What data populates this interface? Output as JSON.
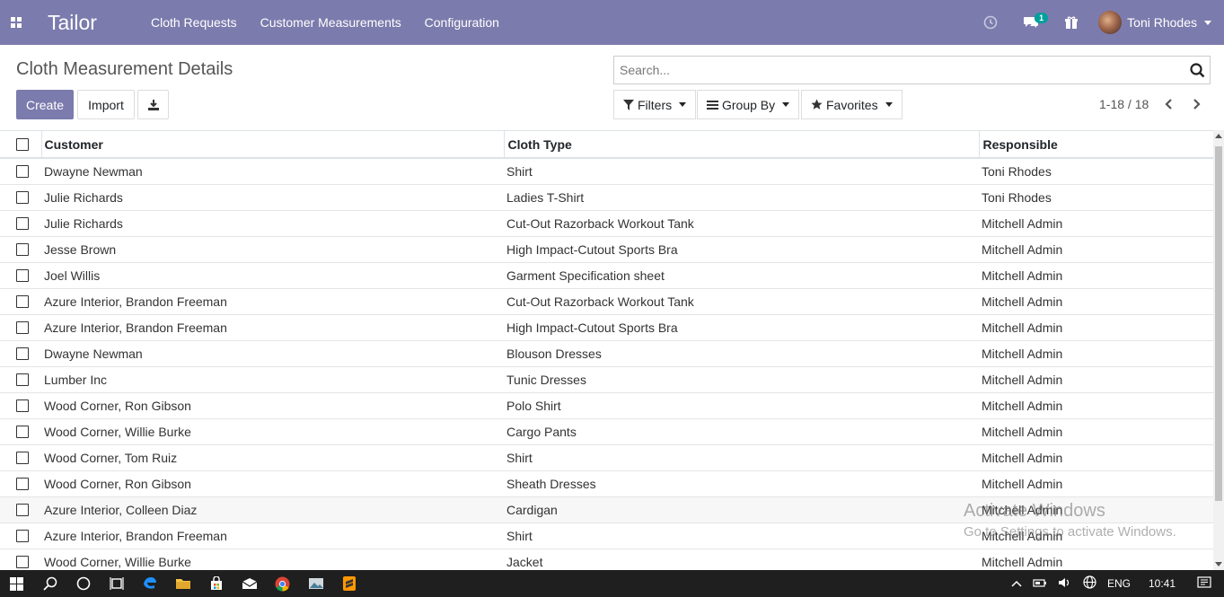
{
  "navbar": {
    "brand": "Tailor",
    "menu": [
      "Cloth Requests",
      "Customer Measurements",
      "Configuration"
    ],
    "chat_badge": "1",
    "user_name": "Toni Rhodes",
    "color": "#7c7bad"
  },
  "control_panel": {
    "title": "Cloth Measurement Details",
    "create_label": "Create",
    "import_label": "Import",
    "search_placeholder": "Search...",
    "filters_label": "Filters",
    "groupby_label": "Group By",
    "favorites_label": "Favorites",
    "pager_text": "1-18 / 18"
  },
  "table": {
    "columns": [
      "Customer",
      "Cloth Type",
      "Responsible"
    ],
    "rows": [
      [
        "Dwayne Newman",
        "Shirt",
        "Toni Rhodes"
      ],
      [
        "Julie Richards",
        "Ladies T-Shirt",
        "Toni Rhodes"
      ],
      [
        "Julie Richards",
        "Cut-Out Razorback Workout Tank",
        "Mitchell Admin"
      ],
      [
        "Jesse Brown",
        "High Impact-Cutout Sports Bra",
        "Mitchell Admin"
      ],
      [
        "Joel Willis",
        "Garment Specification sheet",
        "Mitchell Admin"
      ],
      [
        "Azure Interior, Brandon Freeman",
        "Cut-Out Razorback Workout Tank",
        "Mitchell Admin"
      ],
      [
        "Azure Interior, Brandon Freeman",
        "High Impact-Cutout Sports Bra",
        "Mitchell Admin"
      ],
      [
        "Dwayne Newman",
        "Blouson Dresses",
        "Mitchell Admin"
      ],
      [
        "Lumber Inc",
        "Tunic Dresses",
        "Mitchell Admin"
      ],
      [
        "Wood Corner, Ron Gibson",
        "Polo Shirt",
        "Mitchell Admin"
      ],
      [
        "Wood Corner, Willie Burke",
        "Cargo Pants",
        "Mitchell Admin"
      ],
      [
        "Wood Corner, Tom Ruiz",
        "Shirt",
        "Mitchell Admin"
      ],
      [
        "Wood Corner, Ron Gibson",
        "Sheath Dresses",
        "Mitchell Admin"
      ],
      [
        "Azure Interior, Colleen Diaz",
        "Cardigan",
        "Mitchell Admin"
      ],
      [
        "Azure Interior, Brandon Freeman",
        "Shirt",
        "Mitchell Admin"
      ],
      [
        "Wood Corner, Willie Burke",
        "Jacket",
        "Mitchell Admin"
      ]
    ]
  },
  "watermark": {
    "line1": "Activate Windows",
    "line2": "Go to Settings to activate Windows."
  },
  "taskbar": {
    "language": "ENG",
    "time": "10:41"
  }
}
